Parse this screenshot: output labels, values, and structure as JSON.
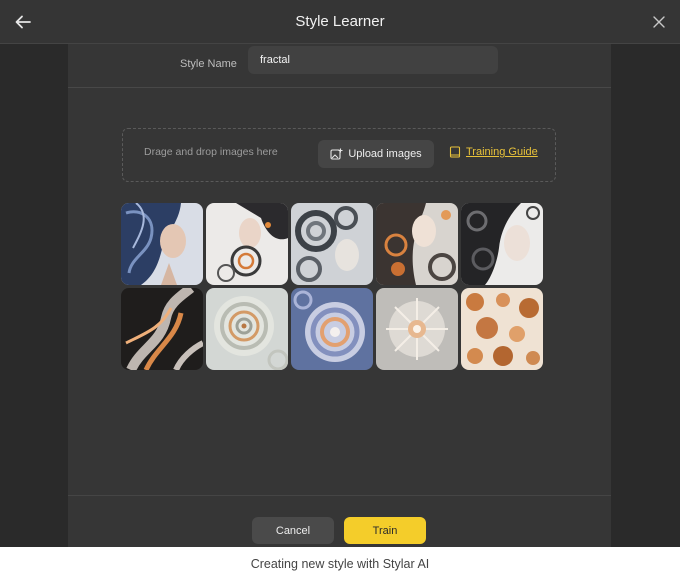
{
  "window": {
    "title": "Style Learner",
    "back_icon": "arrow-left-icon",
    "close_icon": "close-icon"
  },
  "form": {
    "style_name_label": "Style Name",
    "style_name_value": "fractal"
  },
  "upload": {
    "drop_text": "Drage and drop images here",
    "upload_button_label": "Upload images",
    "upload_icon": "image-plus-icon",
    "guide_label": "Training Guide",
    "guide_icon": "book-icon"
  },
  "images": [
    {
      "subject": "woman-blue-swirl-hair"
    },
    {
      "subject": "woman-fractal-profile"
    },
    {
      "subject": "fractal-swirl-face"
    },
    {
      "subject": "woman-orange-fractal"
    },
    {
      "subject": "woman-dark-swirl-hair"
    },
    {
      "subject": "orange-wisps"
    },
    {
      "subject": "nautilus-spiral"
    },
    {
      "subject": "blue-fractal-spiral"
    },
    {
      "subject": "crystalline-starburst"
    },
    {
      "subject": "porous-orange-texture"
    }
  ],
  "actions": {
    "cancel_label": "Cancel",
    "train_label": "Train"
  },
  "caption": "Creating new style with Stylar AI",
  "colors": {
    "accent": "#f4cd2a",
    "link": "#e8c23a",
    "panel": "#363636"
  }
}
